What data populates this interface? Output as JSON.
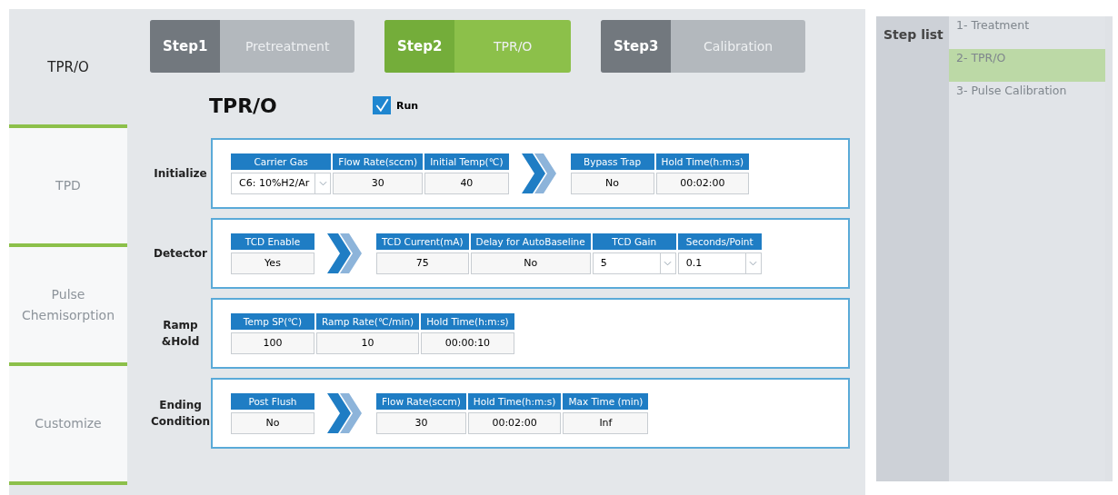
{
  "nav_tabs": [
    {
      "label": "TPR/O",
      "selected": true
    },
    {
      "label": "TPD",
      "selected": false
    },
    {
      "label": "Pulse Chemisorption",
      "selected": false
    },
    {
      "label": "Customize",
      "selected": false
    }
  ],
  "steps": [
    {
      "number": "Step1",
      "name": "Pretreatment",
      "selected": false
    },
    {
      "number": "Step2",
      "name": "TPR/O",
      "selected": true
    },
    {
      "number": "Step3",
      "name": "Calibration",
      "selected": false
    }
  ],
  "title": "TPR/O",
  "run": {
    "label": "Run",
    "checked": true
  },
  "sections": [
    {
      "label": "Initialize",
      "groups": [
        [
          {
            "header": "Carrier Gas",
            "value": "C6: 10%H2/Ar",
            "kind": "dropdown"
          },
          {
            "header": "Flow Rate(sccm)",
            "value": "30",
            "kind": "text"
          },
          {
            "header": "Initial Temp(℃)",
            "value": "40",
            "kind": "text"
          }
        ],
        [
          {
            "header": "Bypass Trap",
            "value": "No",
            "kind": "text"
          },
          {
            "header": "Hold Time(h:m:s)",
            "value": "00:02:00",
            "kind": "text"
          }
        ]
      ]
    },
    {
      "label": "Detector",
      "groups": [
        [
          {
            "header": "TCD Enable",
            "value": "Yes",
            "kind": "text"
          }
        ],
        [
          {
            "header": "TCD Current(mA)",
            "value": "75",
            "kind": "text"
          },
          {
            "header": "Delay for AutoBaseline",
            "value": "No",
            "kind": "text"
          },
          {
            "header": "TCD Gain",
            "value": "5",
            "kind": "dropdown"
          },
          {
            "header": "Seconds/Point",
            "value": "0.1",
            "kind": "dropdown"
          }
        ]
      ]
    },
    {
      "label": "Ramp &Hold",
      "groups": [
        [
          {
            "header": "Temp SP(℃)",
            "value": "100",
            "kind": "text"
          },
          {
            "header": "Ramp Rate(℃/min)",
            "value": "10",
            "kind": "text"
          },
          {
            "header": "Hold Time(h:m:s)",
            "value": "00:00:10",
            "kind": "text"
          }
        ]
      ]
    },
    {
      "label": "Ending Condition",
      "groups": [
        [
          {
            "header": "Post Flush",
            "value": "No",
            "kind": "text"
          }
        ],
        [
          {
            "header": "Flow Rate(sccm)",
            "value": "30",
            "kind": "text"
          },
          {
            "header": "Hold Time(h:m:s)",
            "value": "00:02:00",
            "kind": "text"
          },
          {
            "header": "Max Time (min)",
            "value": "Inf",
            "kind": "text"
          }
        ]
      ]
    }
  ],
  "step_list": {
    "label": "Step list",
    "items": [
      {
        "label": "1- Treatment",
        "selected": false
      },
      {
        "label": "2- TPR/O",
        "selected": true
      },
      {
        "label": "3- Pulse Calibration",
        "selected": false
      }
    ]
  }
}
